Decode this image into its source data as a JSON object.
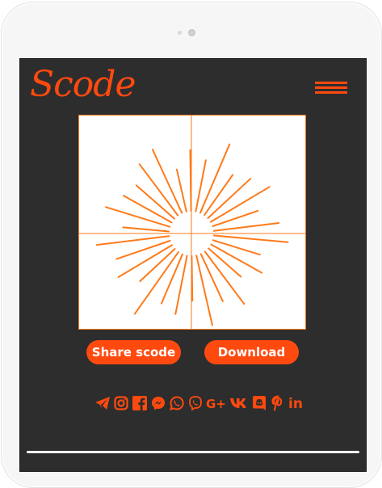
{
  "app": {
    "logo_text": "Scode",
    "accent_color": "#ff4a0f"
  },
  "actions": {
    "share_label": "Share scode",
    "download_label": "Download"
  },
  "social_icons": [
    "telegram-icon",
    "instagram-icon",
    "facebook-icon",
    "messenger-icon",
    "whatsapp-icon",
    "viber-icon",
    "google-plus-icon",
    "vk-icon",
    "discord-icon",
    "pinterest-icon",
    "linkedin-icon"
  ],
  "social_labels": {
    "google_plus": "G+",
    "vk": "VK",
    "linkedin": "in"
  }
}
